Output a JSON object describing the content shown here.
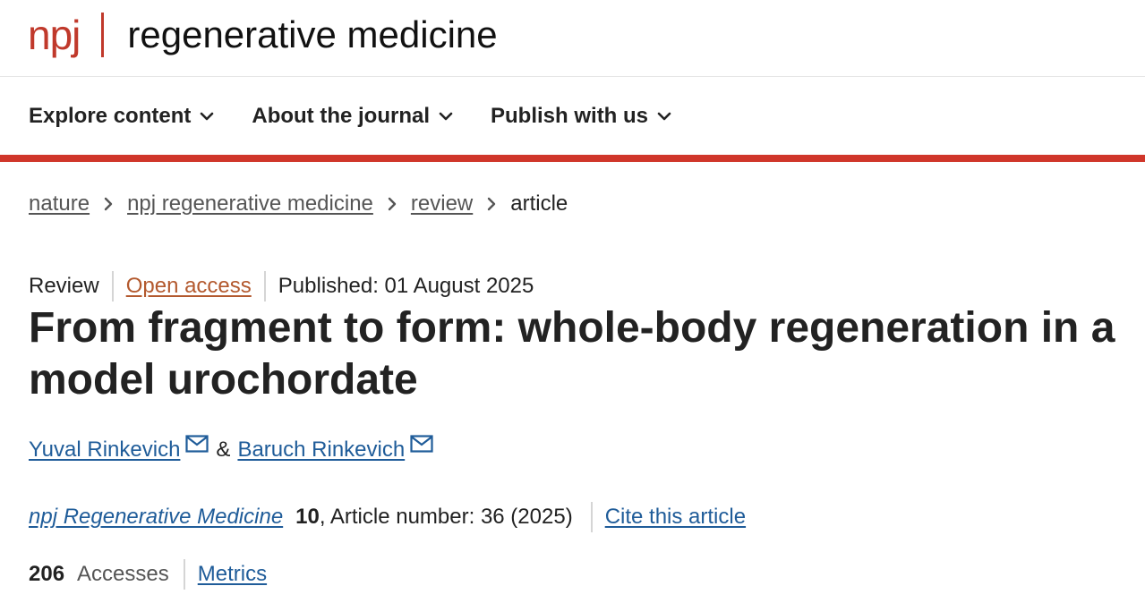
{
  "header": {
    "logo_npj": "npj",
    "logo_title": "regenerative medicine"
  },
  "nav": {
    "items": [
      {
        "label": "Explore content"
      },
      {
        "label": "About the journal"
      },
      {
        "label": "Publish with us"
      }
    ]
  },
  "colors": {
    "brand_red": "#d0362a",
    "link_blue": "#1f5c99",
    "open_access_orange": "#b3592e"
  },
  "breadcrumb": {
    "items": [
      "nature",
      "npj regenerative medicine",
      "review"
    ],
    "current": "article"
  },
  "article": {
    "type": "Review",
    "access": "Open access",
    "published": "Published: 01 August 2025",
    "title": "From fragment to form: whole-body regeneration in a model urochordate",
    "authors": [
      "Yuval Rinkevich",
      "Baruch Rinkevich"
    ],
    "author_separator": "&",
    "journal": "npj Regenerative Medicine",
    "volume": "10",
    "article_number": ", Article number: 36 (2025)",
    "cite_label": "Cite this article",
    "accesses_count": "206",
    "accesses_label": "Accesses",
    "metrics_label": "Metrics"
  },
  "icons": {
    "nav_chevron": "chevron-down-icon",
    "breadcrumb_chevron": "chevron-right-icon",
    "author_mail": "mail-icon"
  }
}
